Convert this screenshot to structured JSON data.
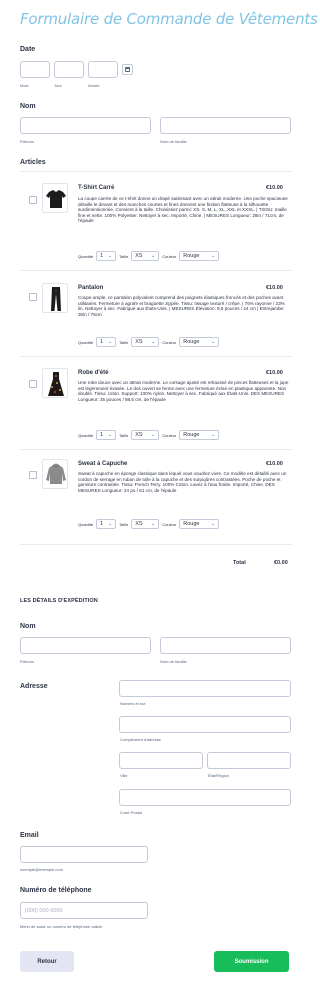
{
  "form": {
    "title": "Formulaire de Commande de Vêtements"
  },
  "date": {
    "label": "Date",
    "month": "Mois",
    "day": "Jour",
    "year": "Année"
  },
  "name": {
    "label": "Nom",
    "first": "Prénom",
    "last": "Nom de famille"
  },
  "articles": {
    "label": "Articles",
    "qty_label": "Quantité",
    "size_label": "Taille",
    "color_label": "Couleur",
    "products": [
      {
        "name": "T-Shirt Carré",
        "price": "€10.00",
        "desc": "La coupe carrée de ce t-shirt donne un drapé saisissant avec un attrait moderne. Une poche spacieuse détaille le devant et des manches courtes et fines donnent une finition flatteuse à la silhouette surdimensionnée. Convient à la taille. Choisissez parmi: XS, S, M, L, XL, XXL et XXXL. | TISSU: maille fine et nette. 100% Polyester. Nettoyer à sec. Importé, Chine. | MESURES Longueur: 28in / 71cm, de l'épaule",
        "qty": "1",
        "size": "XS",
        "color": "Rouge"
      },
      {
        "name": "Pantalon",
        "price": "€10.00",
        "desc": "Coupe ample, ce pantalon polyvalent comprend des poignets élastiques froncés et des poches avant utilitaires. Fermeture à agrafe et braguette zippée. Tissu: tissage texturé / crêpe. | 76% rayonne / 23% lin. Nettoyer à sec. Fabriqué aux États-Unis. | MESURES Élévation: 9,5 pouces / 24 cm | Entrejambe: 30in / 76cm",
        "qty": "1",
        "size": "XS",
        "color": "Rouge"
      },
      {
        "name": "Robe d'été",
        "price": "€10.00",
        "desc": "Une robe douce avec un attrait moderne. Le corsage ajusté est rehaussé de pinces flatteuses et la jupe est légèrement évasée. Le dos ouvert se ferme avec une fermeture éclair en plastique apparente. Non doublé. Tissu: coton. Support: 100% nylon. Nettoyer à sec. Fabriqué aux États-Unis. DES MESURES Longueur: 35 pouces / 88,5 cm, de l'épaule",
        "qty": "1",
        "size": "XS",
        "color": "Rouge"
      },
      {
        "name": "Sweat à Capuche",
        "price": "€10.00",
        "desc": "Sweat à capuche en éponge classique dans lequel vous voudrez vivre. Ce modèle est détaillé avec un cordon de serrage en ruban de toile à la capuche et des surpiqûres contrastées. Poche de poche et garniture contrastée. Tissu: French Terry. 100% Coton. Lavez à l'eau froide. Importé, Chine. DES MESURES Longueur: 24 po / 61 cm, de l'épaule",
        "qty": "1",
        "size": "XS",
        "color": "Rouge"
      }
    ],
    "total_label": "Total",
    "total_value": "€0.00"
  },
  "shipping": {
    "title": "LES DÉTAILS D'EXPÉDITION",
    "name_label": "Nom",
    "first": "Prénom",
    "last": "Nom de famille",
    "address_label": "Adresse",
    "street": "Numéro et rue",
    "complement": "Complément d'adresse",
    "city": "Ville",
    "state": "État/Région",
    "postal": "Code Postal",
    "email_label": "Email",
    "email_hint": "exemple@exemple.com",
    "phone_label": "Numéro de téléphone",
    "phone_placeholder": "(000) 000-0000",
    "phone_hint": "Merci de saisir un numéro de téléphone valide."
  },
  "buttons": {
    "back": "Retour",
    "submit": "Soumission"
  },
  "colors": {
    "title": "#7fc4e6",
    "submit": "#18bd5b",
    "back_bg": "#e3e5f2",
    "border": "#c3cad8"
  },
  "icons": [
    "calendar-icon",
    "chevron-down-icon"
  ]
}
